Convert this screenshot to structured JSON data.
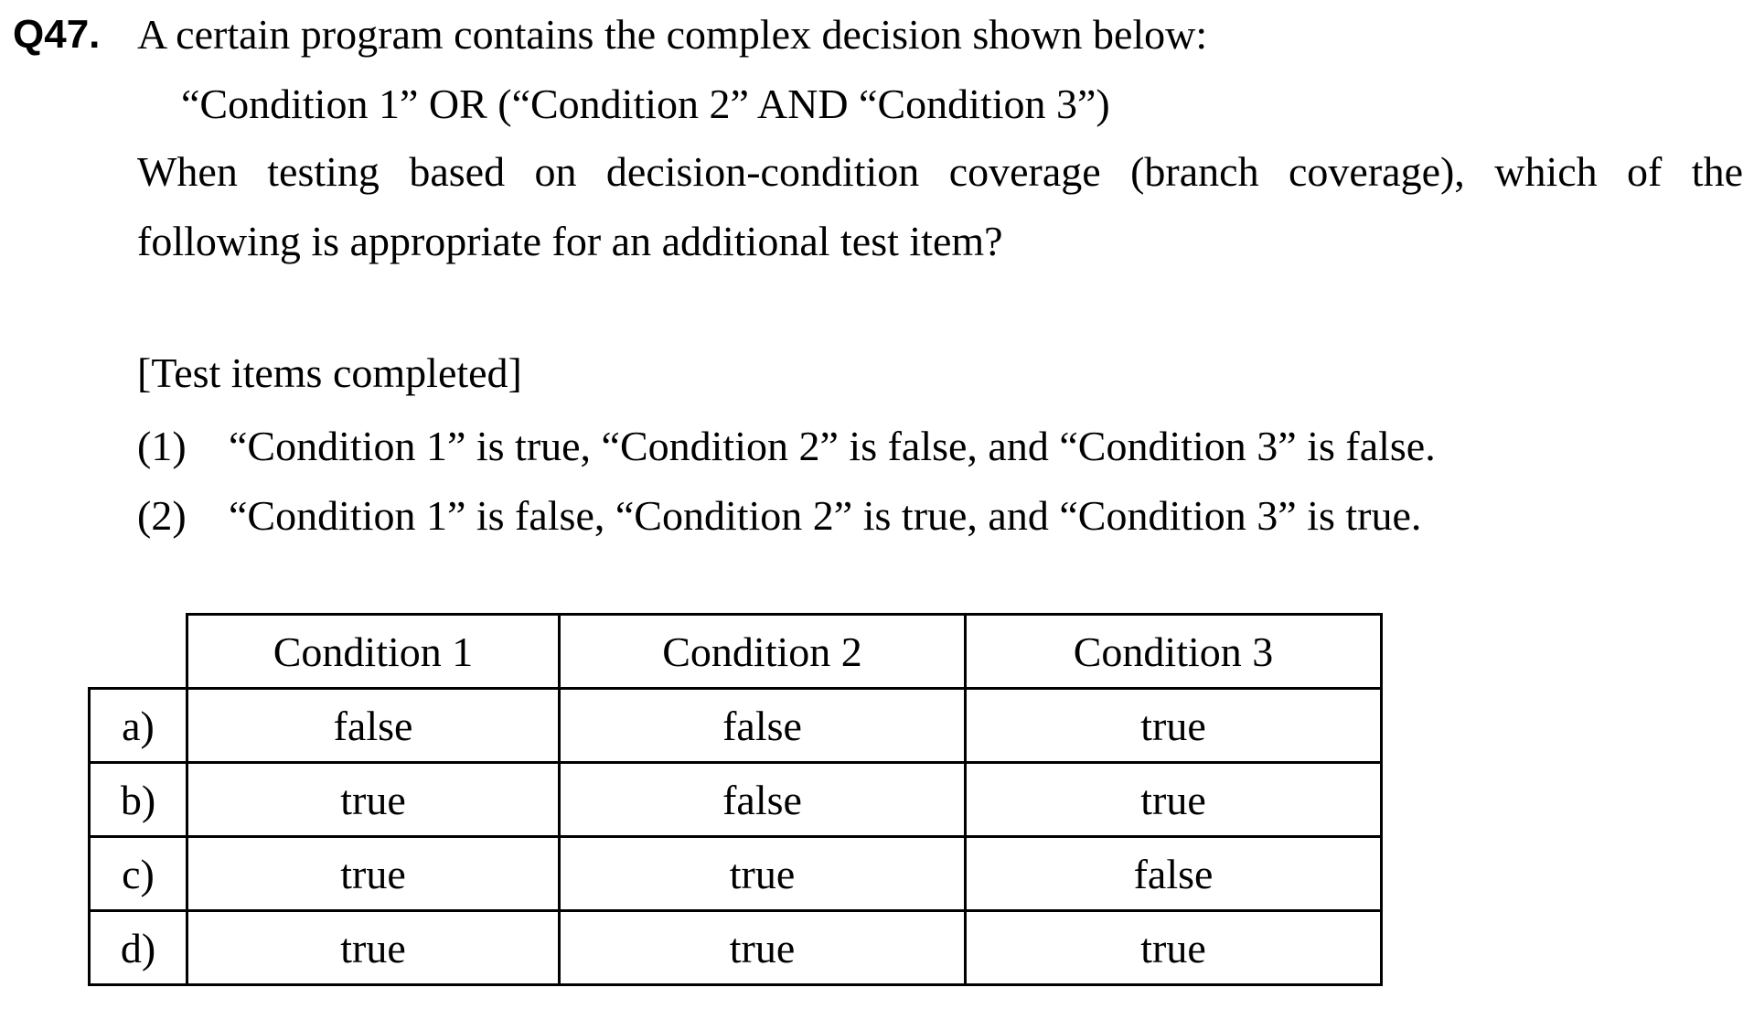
{
  "question": {
    "number": "Q47.",
    "intro": "A certain program contains the complex decision shown below:",
    "expression": "“Condition 1” OR (“Condition 2” AND “Condition 3”)",
    "body_line1": "When testing based on decision-condition coverage (branch coverage), which of the",
    "body_line2": "following is appropriate for an additional test item?"
  },
  "completed": {
    "heading": "[Test items completed]",
    "items": [
      {
        "num": "(1)",
        "text": "“Condition 1” is true, “Condition 2” is false, and “Condition 3” is false."
      },
      {
        "num": "(2)",
        "text": "“Condition 1” is false, “Condition 2” is true, and “Condition 3” is true."
      }
    ]
  },
  "table": {
    "headers": [
      "Condition 1",
      "Condition 2",
      "Condition 3"
    ],
    "rows": [
      {
        "label": "a)",
        "cells": [
          "false",
          "false",
          "true"
        ]
      },
      {
        "label": "b)",
        "cells": [
          "true",
          "false",
          "true"
        ]
      },
      {
        "label": "c)",
        "cells": [
          "true",
          "true",
          "false"
        ]
      },
      {
        "label": "d)",
        "cells": [
          "true",
          "true",
          "true"
        ]
      }
    ]
  }
}
